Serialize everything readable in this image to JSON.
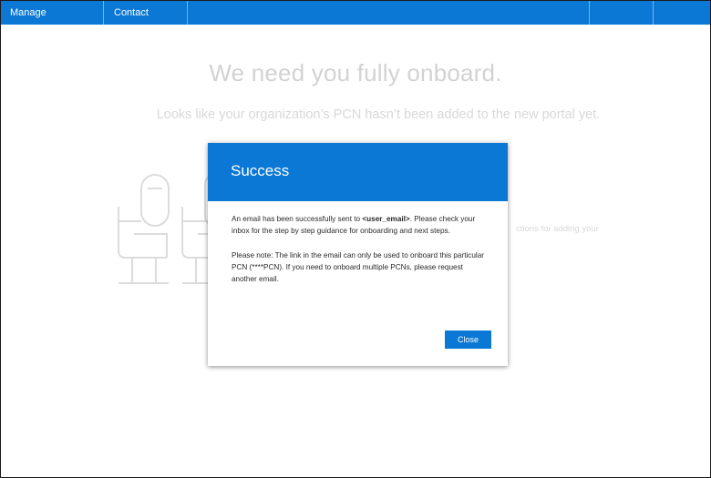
{
  "nav": {
    "items": [
      {
        "label": "Manage Subscriptions"
      },
      {
        "label": "Contact Support"
      }
    ]
  },
  "page": {
    "headline": "We need you fully onboard.",
    "subhead": "Looks like your organization’s PCN hasn’t been added to the new portal yet.",
    "side_text": "ctions for adding your"
  },
  "modal": {
    "title": "Success",
    "body_p1_before": "An email has been successfully sent to ",
    "body_p1_email": "<user_email>",
    "body_p1_after": ". Please check your inbox for the step by step guidance for onboarding and next steps.",
    "body_p2": "Please note: The link in the email can only be used to onboard this particular PCN (****PCN). If you need to onboard multiple PCNs, please request another email.",
    "close_label": "Close"
  },
  "colors": {
    "accent": "#0a78d4",
    "dim_text": "#d2d2d2",
    "dim_illustration": "#dcdcdc"
  },
  "icons": {
    "background_illustration": "seats-illustration"
  }
}
